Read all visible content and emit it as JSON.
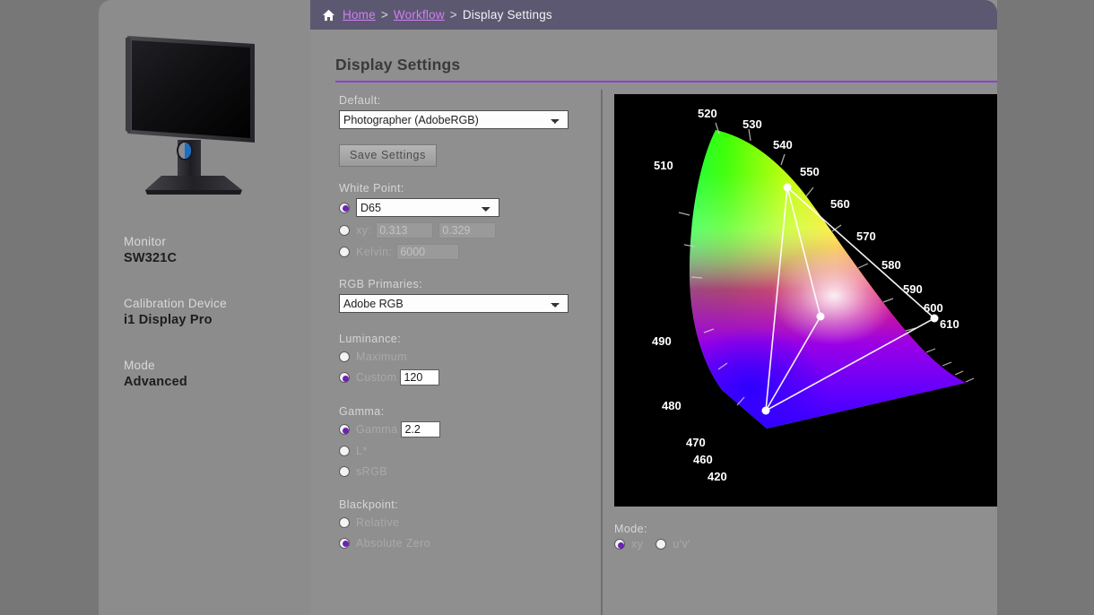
{
  "breadcrumb": {
    "home_icon": "home-icon",
    "home": "Home",
    "sep1": ">",
    "workflow": "Workflow",
    "sep2": ">",
    "current": "Display Settings"
  },
  "page": {
    "title": "Display Settings",
    "accent_color": "#8e3fd4"
  },
  "sidebar": {
    "monitor_label": "Monitor",
    "monitor_value": "SW321C",
    "device_label": "Calibration Device",
    "device_value": "i1 Display Pro",
    "mode_label": "Mode",
    "mode_value": "Advanced"
  },
  "form": {
    "default_label": "Default:",
    "default_value": "Photographer (AdobeRGB)",
    "default_options": [
      "Photographer (AdobeRGB)"
    ],
    "save_label": "Save Settings",
    "whitepoint_label": "White Point:",
    "whitepoint_preset_value": "D65",
    "whitepoint_preset_options": [
      "D65"
    ],
    "xy_label": "xy:",
    "xy_x": "0.313",
    "xy_y": "0.329",
    "kelvin_label": "Kelvin:",
    "kelvin_value": "6000",
    "primaries_label": "RGB Primaries:",
    "primaries_value": "Adobe RGB",
    "primaries_options": [
      "Adobe RGB"
    ],
    "luminance_label": "Luminance:",
    "luminance_maximum": "Maximum",
    "luminance_custom": "Custom",
    "luminance_custom_value": "120",
    "gamma_label": "Gamma:",
    "gamma_gamma": "Gamma",
    "gamma_value": "2.2",
    "gamma_lstar": "L*",
    "gamma_srgb": "sRGB",
    "blackpoint_label": "Blackpoint:",
    "blackpoint_relative": "Relative",
    "blackpoint_absolute": "Absolute Zero"
  },
  "diagram": {
    "mode_label": "Mode:",
    "mode_xy": "xy",
    "mode_uv": "u'v'",
    "wavelength_labels": [
      "420",
      "460",
      "470",
      "480",
      "490",
      "510",
      "520",
      "530",
      "540",
      "550",
      "560",
      "570",
      "580",
      "590",
      "600",
      "610"
    ],
    "gamut_name": "Adobe RGB",
    "vertices": {
      "red": "610",
      "green": "520",
      "blue": "470"
    }
  }
}
